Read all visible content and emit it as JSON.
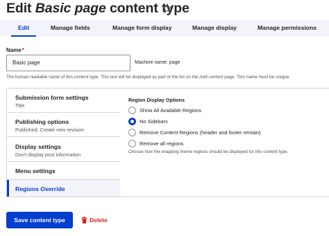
{
  "header": {
    "title_prefix": "Edit ",
    "title_em": "Basic page",
    "title_suffix": " content type"
  },
  "tabs": [
    {
      "label": "Edit",
      "active": true
    },
    {
      "label": "Manage fields",
      "active": false
    },
    {
      "label": "Manage form display",
      "active": false
    },
    {
      "label": "Manage display",
      "active": false
    },
    {
      "label": "Manage permissions",
      "active": false
    }
  ],
  "name_field": {
    "label": "Name",
    "required_mark": "*",
    "value": "Basic page",
    "machine_name": "Machine name: page",
    "description": "The human-readable name of this content type. This text will be displayed as part of the list on the Add content page. This name must be unique."
  },
  "vertical_tabs": [
    {
      "title": "Submission form settings",
      "summary": "Title"
    },
    {
      "title": "Publishing options",
      "summary": "Published, Create new revision"
    },
    {
      "title": "Display settings",
      "summary": "Don't display post information"
    },
    {
      "title": "Menu settings",
      "summary": ""
    },
    {
      "title": "Regions Override",
      "summary": "",
      "selected": true
    }
  ],
  "region_display": {
    "title": "Region Display Options",
    "options": [
      {
        "label": "Show All Available Regions",
        "checked": false
      },
      {
        "label": "No Sidebars",
        "checked": true
      },
      {
        "label": "Remove Content Regions (header and footer remain)",
        "checked": false
      },
      {
        "label": "Remove all regions",
        "checked": false
      }
    ],
    "description": "Choose how the wrapping theme regions should be displayed for this content type."
  },
  "actions": {
    "save_label": "Save content type",
    "delete_label": "Delete"
  },
  "colors": {
    "accent": "#003ecc",
    "danger": "#d72222",
    "tab_bar": "#f3f4f9"
  },
  "icons": {
    "favorite": "star-icon",
    "delete": "trash-icon"
  }
}
